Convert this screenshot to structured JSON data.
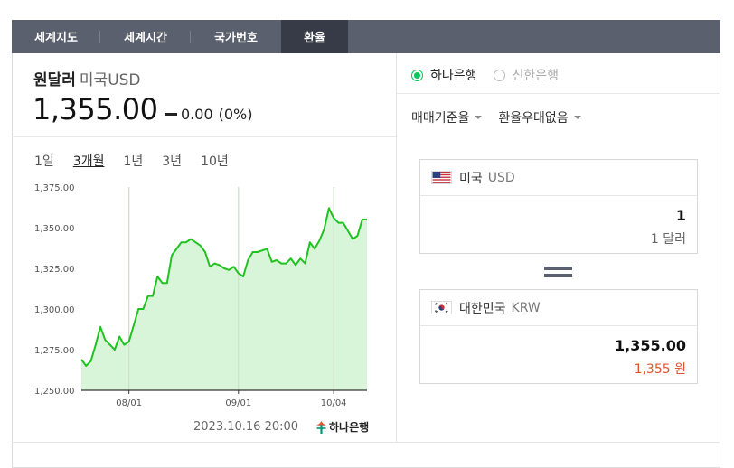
{
  "tabs": [
    {
      "label": "세계지도",
      "active": false
    },
    {
      "label": "세계시간",
      "active": false
    },
    {
      "label": "국가번호",
      "active": false
    },
    {
      "label": "환율",
      "active": true
    }
  ],
  "currency": {
    "title": "원달러",
    "subtitle": "미국USD",
    "rate": "1,355.00",
    "change_value": "0.00",
    "change_pct": "(0%)"
  },
  "periods": [
    {
      "label": "1일",
      "active": false
    },
    {
      "label": "3개월",
      "active": true
    },
    {
      "label": "1년",
      "active": false
    },
    {
      "label": "3년",
      "active": false
    },
    {
      "label": "10년",
      "active": false
    }
  ],
  "chart_data": {
    "type": "area",
    "title": "",
    "xlabel": "",
    "ylabel": "",
    "ylim": [
      1250,
      1375
    ],
    "yticks": [
      "1,375.00",
      "1,350.00",
      "1,325.00",
      "1,300.00",
      "1,275.00",
      "1,250.00"
    ],
    "xticks": [
      {
        "label": "08/01",
        "index": 10
      },
      {
        "label": "09/01",
        "index": 33
      },
      {
        "label": "10/04",
        "index": 53
      }
    ],
    "grid": "vertical",
    "color": "#1fc21f",
    "fill": "#d9f5d9",
    "series": [
      {
        "values": [
          1269,
          1265,
          1268,
          1278,
          1289,
          1281,
          1278,
          1275,
          1283,
          1278,
          1280,
          1290,
          1300,
          1300,
          1308,
          1308,
          1320,
          1316,
          1316,
          1333,
          1337,
          1341,
          1341,
          1343,
          1341,
          1339,
          1335,
          1326,
          1328,
          1327,
          1325,
          1324,
          1326,
          1322,
          1320,
          1330,
          1335,
          1335,
          1336,
          1337,
          1329,
          1330,
          1328,
          1328,
          1331,
          1327,
          1331,
          1328,
          1341,
          1337,
          1342,
          1349,
          1362,
          1356,
          1353,
          1353,
          1348,
          1343,
          1345,
          1355,
          1355
        ]
      }
    ]
  },
  "timestamp": "2023.10.16 20:00",
  "bank_logo_text": "하나은행",
  "banks": [
    {
      "label": "하나은행",
      "selected": true
    },
    {
      "label": "신한은행",
      "selected": false
    }
  ],
  "dropdowns": [
    {
      "label": "매매기준율"
    },
    {
      "label": "환율우대없음"
    }
  ],
  "from": {
    "country": "미국",
    "code": "USD",
    "amount": "1",
    "unit_text": "1 달러"
  },
  "to": {
    "country": "대한민국",
    "code": "KRW",
    "amount": "1,355.00",
    "unit_text": "1,355 원"
  }
}
